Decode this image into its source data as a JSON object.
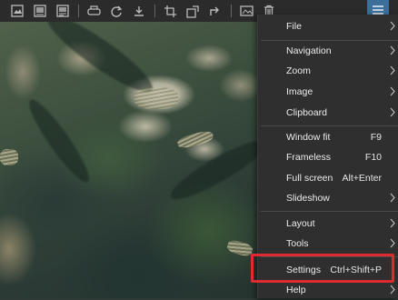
{
  "toolbar": {
    "icons": [
      "open-file-icon",
      "gallery-icon",
      "slideshow-icon",
      "print-icon",
      "refresh-icon",
      "save-icon",
      "crop-icon",
      "resize-icon",
      "share-icon",
      "image-edit-icon",
      "delete-icon",
      "menu-icon"
    ]
  },
  "menu": {
    "items": [
      {
        "label": "File",
        "submenu": true
      },
      {
        "label": "Navigation",
        "submenu": true
      },
      {
        "label": "Zoom",
        "submenu": true
      },
      {
        "label": "Image",
        "submenu": true
      },
      {
        "label": "Clipboard",
        "submenu": true
      },
      {
        "label": "Window fit",
        "shortcut": "F9"
      },
      {
        "label": "Frameless",
        "shortcut": "F10"
      },
      {
        "label": "Full screen",
        "shortcut": "Alt+Enter"
      },
      {
        "label": "Slideshow",
        "submenu": true
      },
      {
        "label": "Layout",
        "submenu": true
      },
      {
        "label": "Tools",
        "submenu": true
      },
      {
        "label": "Settings",
        "shortcut": "Ctrl+Shift+P"
      },
      {
        "label": "Help",
        "submenu": true
      }
    ]
  },
  "colors": {
    "toolbar_bg": "#2b2b2b",
    "menu_bg": "#2f2f2f",
    "menu_button_accent": "#3c6f9c",
    "highlight_box": "#e02a31"
  }
}
